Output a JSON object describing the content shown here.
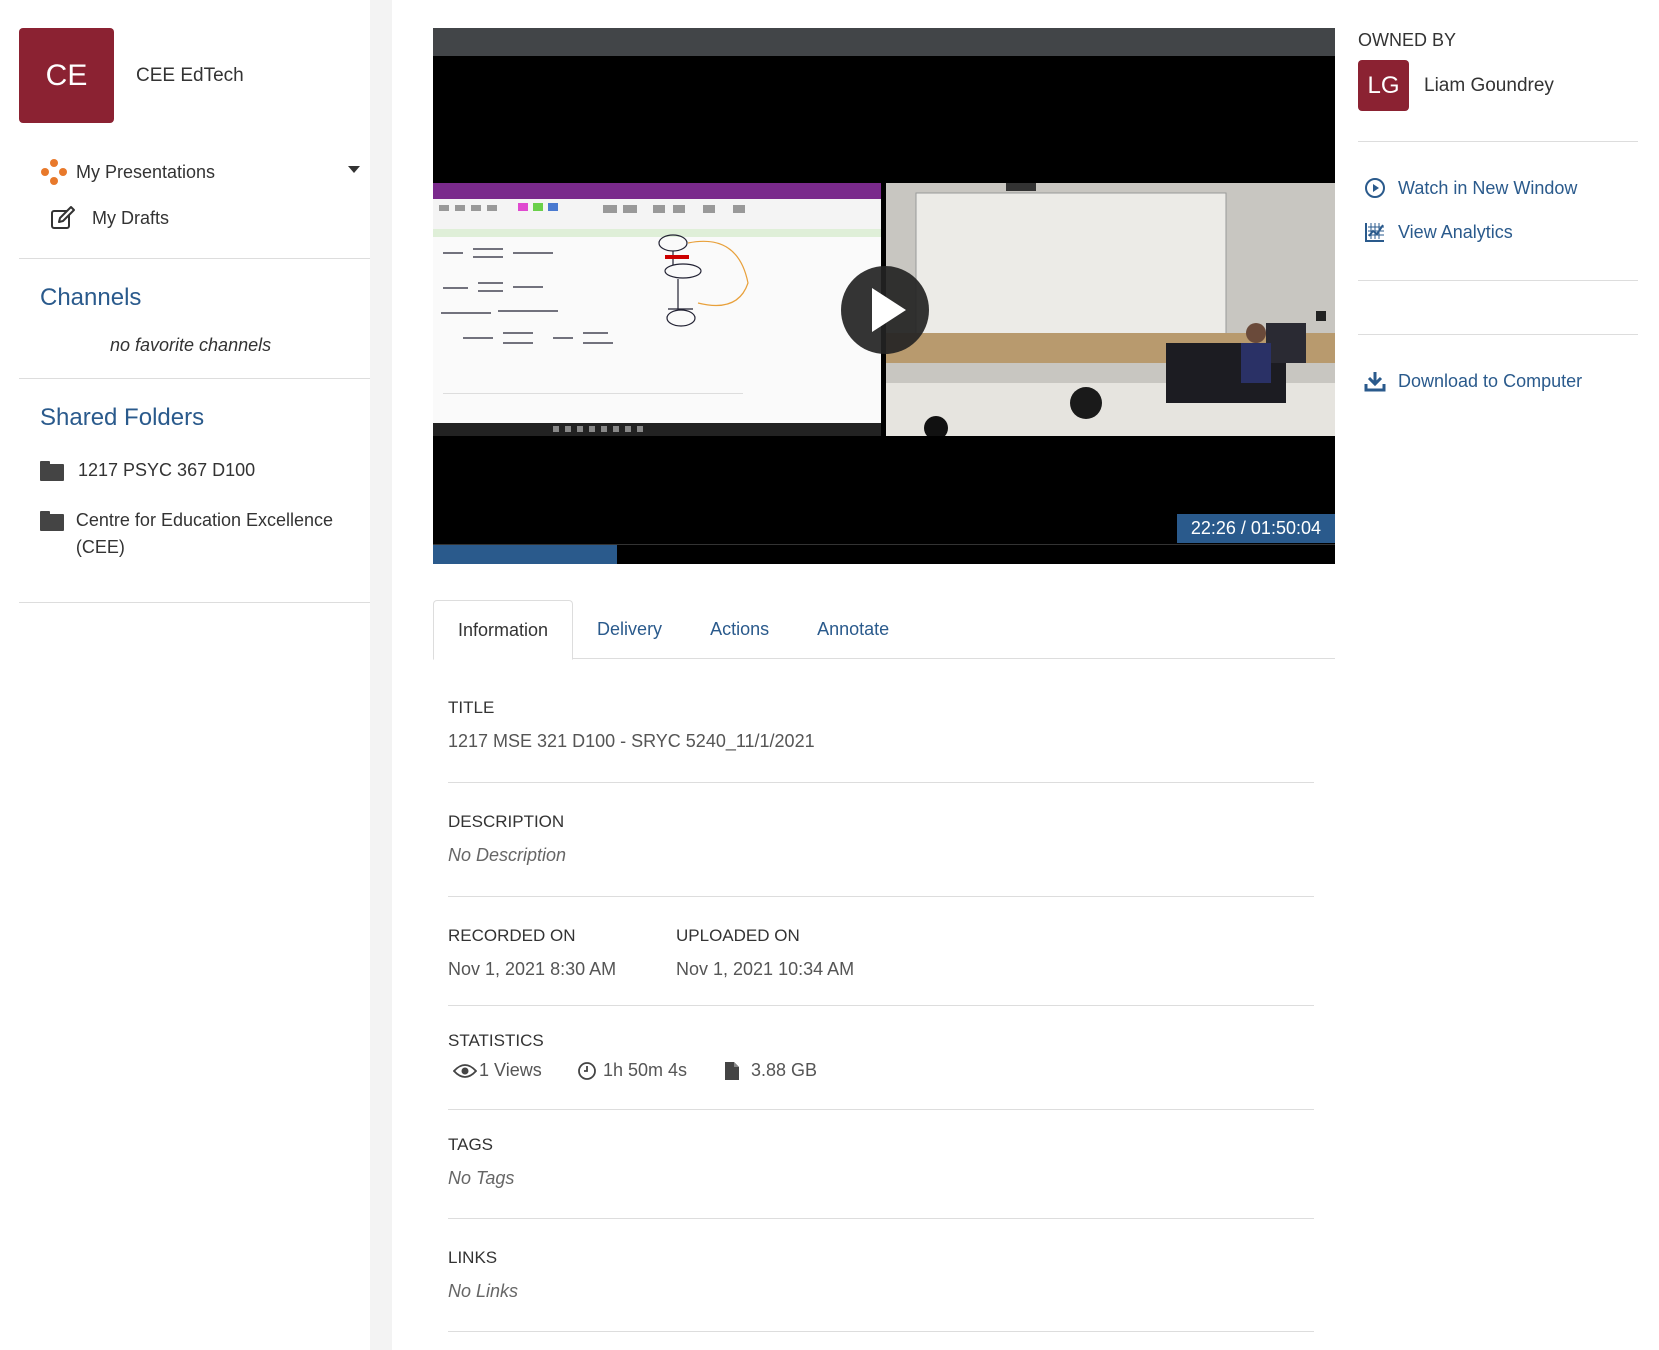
{
  "account": {
    "initials": "CE",
    "name": "CEE EdTech"
  },
  "nav": {
    "presentations": "My Presentations",
    "drafts": "My Drafts"
  },
  "channels": {
    "heading": "Channels",
    "empty": "no favorite channels"
  },
  "shared_folders": {
    "heading": "Shared Folders",
    "items": [
      {
        "name": "1217 PSYC 367 D100"
      },
      {
        "name": "Centre for Education Excellence (CEE)"
      }
    ]
  },
  "player": {
    "timecode": "22:26 / 01:50:04",
    "progress": 0.204
  },
  "owner": {
    "label": "OWNED BY",
    "initials": "LG",
    "name": "Liam Goundrey"
  },
  "actions": {
    "watch": "Watch in New Window",
    "analytics": "View Analytics",
    "download": "Download to Computer"
  },
  "tabs": [
    "Information",
    "Delivery",
    "Actions",
    "Annotate"
  ],
  "info": {
    "title_label": "TITLE",
    "title_value": "1217 MSE 321 D100 - SRYC 5240_11/1/2021",
    "description_label": "DESCRIPTION",
    "description_value": "No Description",
    "recorded_label": "RECORDED ON",
    "recorded_value": "Nov 1, 2021 8:30 AM",
    "uploaded_label": "UPLOADED ON",
    "uploaded_value": "Nov 1, 2021 10:34 AM",
    "statistics_label": "STATISTICS",
    "views": "1 Views",
    "duration": "1h 50m 4s",
    "size": "3.88 GB",
    "tags_label": "TAGS",
    "tags_value": "No Tags",
    "links_label": "LINKS",
    "links_value": "No Links"
  },
  "colors": {
    "brand": "#8b2232",
    "link": "#2a5a8c"
  }
}
